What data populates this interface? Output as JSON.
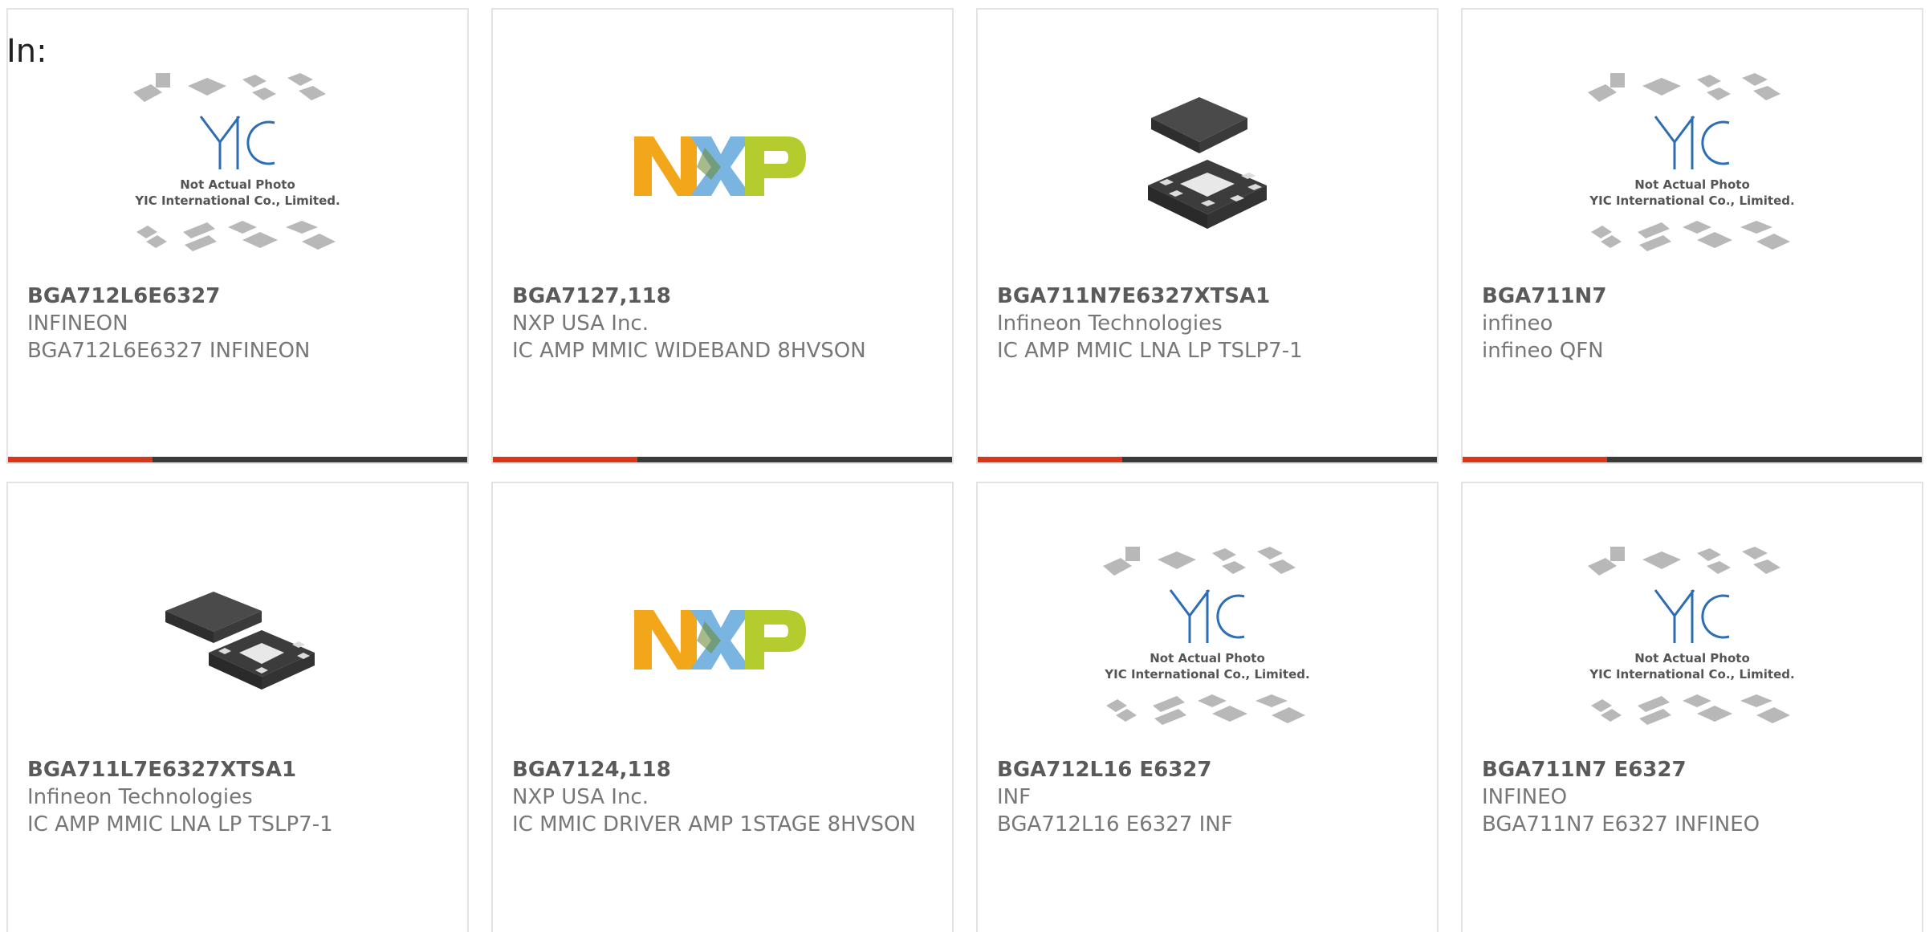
{
  "header": {
    "in_label": "In:"
  },
  "placeholder_image": {
    "line1": "Not Actual Photo",
    "line2": "YIC International Co., Limited.",
    "logo_text": "YIC"
  },
  "nxp_logo": {
    "text": "NXP"
  },
  "colors": {
    "accent": "#d9361a",
    "bar": "#3a3a3a",
    "text_muted": "#777777",
    "part_text": "#5a5a5a"
  },
  "products": [
    {
      "part": "BGA712L6E6327",
      "manufacturer": "INFINEON",
      "description": "BGA712L6E6327 INFINEON",
      "image": "yic-placeholder-image",
      "has_bar": true
    },
    {
      "part": "BGA7127,118",
      "manufacturer": "NXP USA Inc.",
      "description": "IC AMP MMIC WIDEBAND 8HVSON",
      "image": "nxp-logo",
      "has_bar": true
    },
    {
      "part": "BGA711N7E6327XTSA1",
      "manufacturer": "Infineon Technologies",
      "description": "IC AMP MMIC LNA LP TSLP7-1",
      "image": "chip-package-photo",
      "has_bar": true
    },
    {
      "part": "BGA711N7",
      "manufacturer": "infineo",
      "description": "infineo QFN",
      "image": "yic-placeholder-image",
      "has_bar": true
    },
    {
      "part": "BGA711L7E6327XTSA1",
      "manufacturer": "Infineon Technologies",
      "description": "IC AMP MMIC LNA LP TSLP7-1",
      "image": "chip-package-photo",
      "has_bar": false
    },
    {
      "part": "BGA7124,118",
      "manufacturer": "NXP USA Inc.",
      "description": "IC MMIC DRIVER AMP 1STAGE 8HVSON",
      "image": "nxp-logo",
      "has_bar": false
    },
    {
      "part": "BGA712L16 E6327",
      "manufacturer": "INF",
      "description": "BGA712L16 E6327 INF",
      "image": "yic-placeholder-image",
      "has_bar": false
    },
    {
      "part": "BGA711N7 E6327",
      "manufacturer": "INFINEO",
      "description": "BGA711N7 E6327 INFINEO",
      "image": "yic-placeholder-image",
      "has_bar": false
    }
  ]
}
